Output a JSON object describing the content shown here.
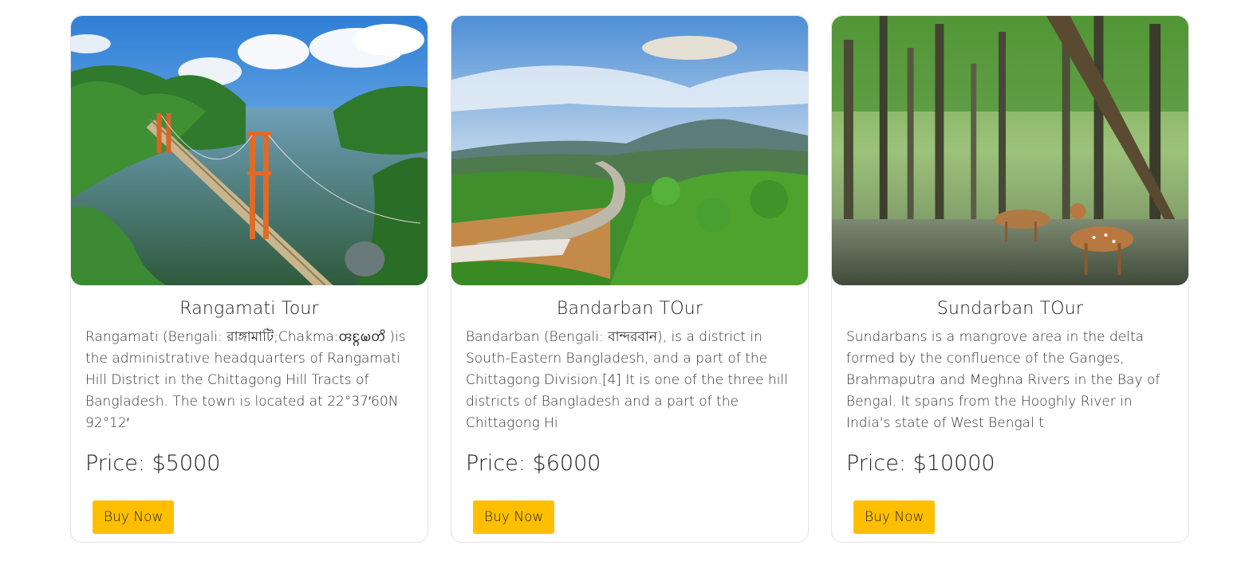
{
  "cards": [
    {
      "title": "Rangamati Tour",
      "description": "Rangamati (Bengali: রাঙ্গামাটি;Chakma:𑄢𑄋𑄳𑄉𑄟𑄖𑄨 )is the administrative headquarters of Rangamati Hill District in the Chittagong Hill Tracts of Bangladesh. The town is located at 22°37′60N 92°12′",
      "price": "Price: $5000",
      "button_label": "Buy Now",
      "image": "suspension-bridge-over-lake"
    },
    {
      "title": "Bandarban TOur",
      "description": "Bandarban (Bengali: বান্দরবান), is a district in South-Eastern Bangladesh, and a part of the Chittagong Division.[4] It is one of the three hill districts of Bangladesh and a part of the Chittagong Hi",
      "price": "Price: $6000",
      "button_label": "Buy Now",
      "image": "hill-road-landscape"
    },
    {
      "title": "Sundarban TOur",
      "description": "Sundarbans is a mangrove area in the delta formed by the confluence of the Ganges, Brahmaputra and Meghna Rivers in the Bay of Bengal. It spans from the Hooghly River in India's state of West Bengal t",
      "price": "Price: $10000",
      "button_label": "Buy Now",
      "image": "deer-in-mangrove-forest"
    }
  ],
  "colors": {
    "button": "#ffbf00",
    "card_border": "#e3e3e3"
  }
}
